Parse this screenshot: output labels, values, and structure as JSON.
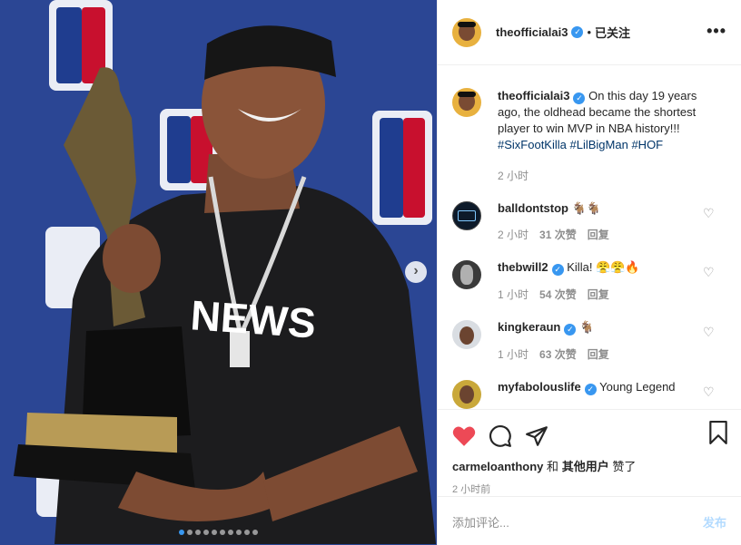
{
  "media": {
    "photo_alt": "Smiling player in black headband and black shirt holding MVP trophy in front of blue NBA logo backdrop",
    "shirt_text": "NEWS",
    "slide_count": 10,
    "active_slide": 1
  },
  "post_header": {
    "username": "theofficialai3",
    "separator": "•",
    "follow_status": "已关注",
    "more": "•••"
  },
  "caption": {
    "username": "theofficialai3",
    "text": "On this day 19 years ago, the oldhead became the shortest player to win MVP in NBA history!!! ",
    "hashtags": [
      "#SixFootKilla",
      "#LilBigMan",
      "#HOF"
    ],
    "time": "2 小时"
  },
  "comments": [
    {
      "username": "balldontstop",
      "verified": false,
      "text": "🐐🐐",
      "time": "2 小时",
      "likes": "31 次赞",
      "reply": "回复"
    },
    {
      "username": "thebwill2",
      "verified": true,
      "text": "Killa! 😤😤🔥",
      "time": "1 小时",
      "likes": "54 次赞",
      "reply": "回复"
    },
    {
      "username": "kingkeraun",
      "verified": true,
      "text": "🐐",
      "time": "1 小时",
      "likes": "63 次赞",
      "reply": "回复"
    },
    {
      "username": "myfabolouslife",
      "verified": true,
      "text": "Young Legend",
      "time": "",
      "likes": "",
      "reply": ""
    }
  ],
  "likes_line": {
    "user": "carmeloanthony",
    "and": "和",
    "others": "其他用户",
    "liked": "赞了"
  },
  "post_time": "2 小时前",
  "add_comment": {
    "placeholder": "添加评论...",
    "post_label": "发布"
  },
  "colors": {
    "accent_blue": "#3897f0",
    "like_red": "#ed4956",
    "backdrop_blue": "#2f4a97"
  }
}
